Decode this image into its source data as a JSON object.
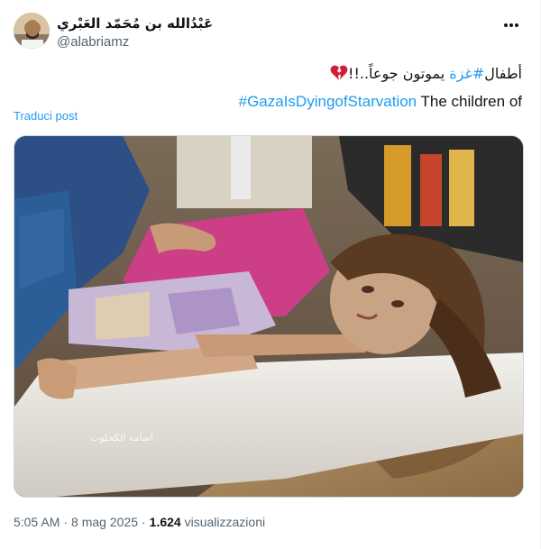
{
  "author": {
    "display_name": "عَبْدُالله بن مُحَمّد العَبْري",
    "handle": "@alabriamz",
    "avatar_icon": "profile-photo"
  },
  "tweet": {
    "line1_text": " يموتون جوعاً..!!",
    "line1_prefix": "أطفال ",
    "line1_hashtag": "#غزة",
    "line1_emoji": "broken-heart-icon",
    "line2_hashtag": "#GazaIsDyingofStarvation",
    "line2_text": " The children of",
    "translate_label": "Traduci post"
  },
  "media": {
    "watermark": "اسامة الكحلوت"
  },
  "meta": {
    "time": "5:05 AM",
    "dot1": "·",
    "date": "8 mag 2025",
    "dot2": "·",
    "views_count": "1.624",
    "views_label": " visualizzazioni"
  },
  "colors": {
    "link": "#1d9bf0",
    "secondary": "#536471",
    "primary_text": "#0f1419",
    "heart": "#d2203a"
  }
}
